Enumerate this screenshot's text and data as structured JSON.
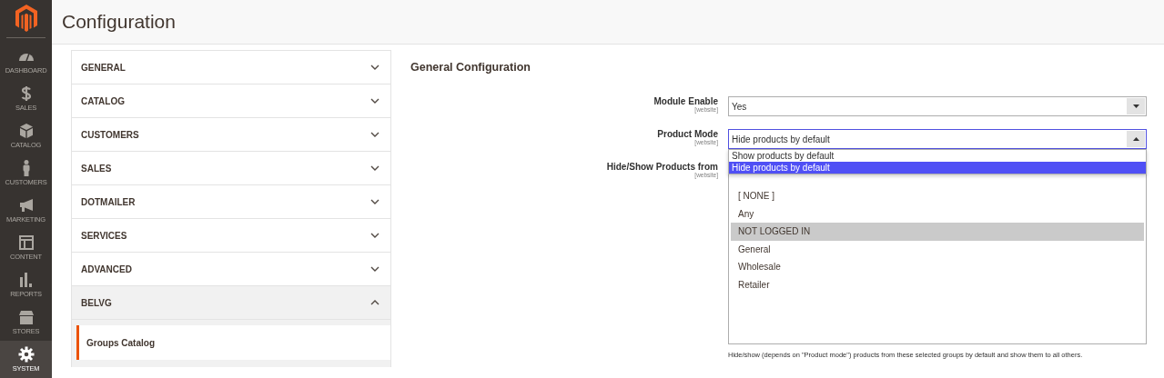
{
  "page_title": "Configuration",
  "nav": [
    {
      "label": "DASHBOARD",
      "kind": "dashboard",
      "selected": false
    },
    {
      "label": "SALES",
      "kind": "sales",
      "selected": false
    },
    {
      "label": "CATALOG",
      "kind": "catalog",
      "selected": false
    },
    {
      "label": "CUSTOMERS",
      "kind": "customers",
      "selected": false
    },
    {
      "label": "MARKETING",
      "kind": "marketing",
      "selected": false
    },
    {
      "label": "CONTENT",
      "kind": "content",
      "selected": false
    },
    {
      "label": "REPORTS",
      "kind": "reports",
      "selected": false
    },
    {
      "label": "STORES",
      "kind": "stores",
      "selected": false
    },
    {
      "label": "SYSTEM",
      "kind": "system",
      "selected": true
    }
  ],
  "sections": [
    {
      "label": "GENERAL",
      "expanded": false
    },
    {
      "label": "CATALOG",
      "expanded": false
    },
    {
      "label": "CUSTOMERS",
      "expanded": false
    },
    {
      "label": "SALES",
      "expanded": false
    },
    {
      "label": "DOTMAILER",
      "expanded": false
    },
    {
      "label": "SERVICES",
      "expanded": false
    },
    {
      "label": "ADVANCED",
      "expanded": false
    },
    {
      "label": "BELVG",
      "expanded": true,
      "children": [
        {
          "label": "Groups Catalog",
          "selected": true
        }
      ]
    }
  ],
  "form": {
    "title": "General Configuration",
    "fields": [
      {
        "kind": "select",
        "label": "Module Enable",
        "scope": "[website]",
        "value": "Yes",
        "open": false
      },
      {
        "kind": "select",
        "label": "Product Mode",
        "scope": "[website]",
        "value": "Hide products by default",
        "open": true,
        "options": [
          {
            "label": "Show products by default",
            "selected": false
          },
          {
            "label": "Hide products by default",
            "selected": true
          }
        ]
      },
      {
        "kind": "multiselect",
        "label": "Hide/Show Products from",
        "scope": "[website]",
        "options": [
          {
            "label": "[ NONE ]",
            "selected": false
          },
          {
            "label": "Any",
            "selected": false
          },
          {
            "label": "NOT LOGGED IN",
            "selected": true
          },
          {
            "label": "General",
            "selected": false
          },
          {
            "label": "Wholesale",
            "selected": false
          },
          {
            "label": "Retailer",
            "selected": false
          }
        ],
        "note": "Hide/show (depends on \"Product mode\") products from these selected groups by default and show them to all others."
      }
    ]
  }
}
